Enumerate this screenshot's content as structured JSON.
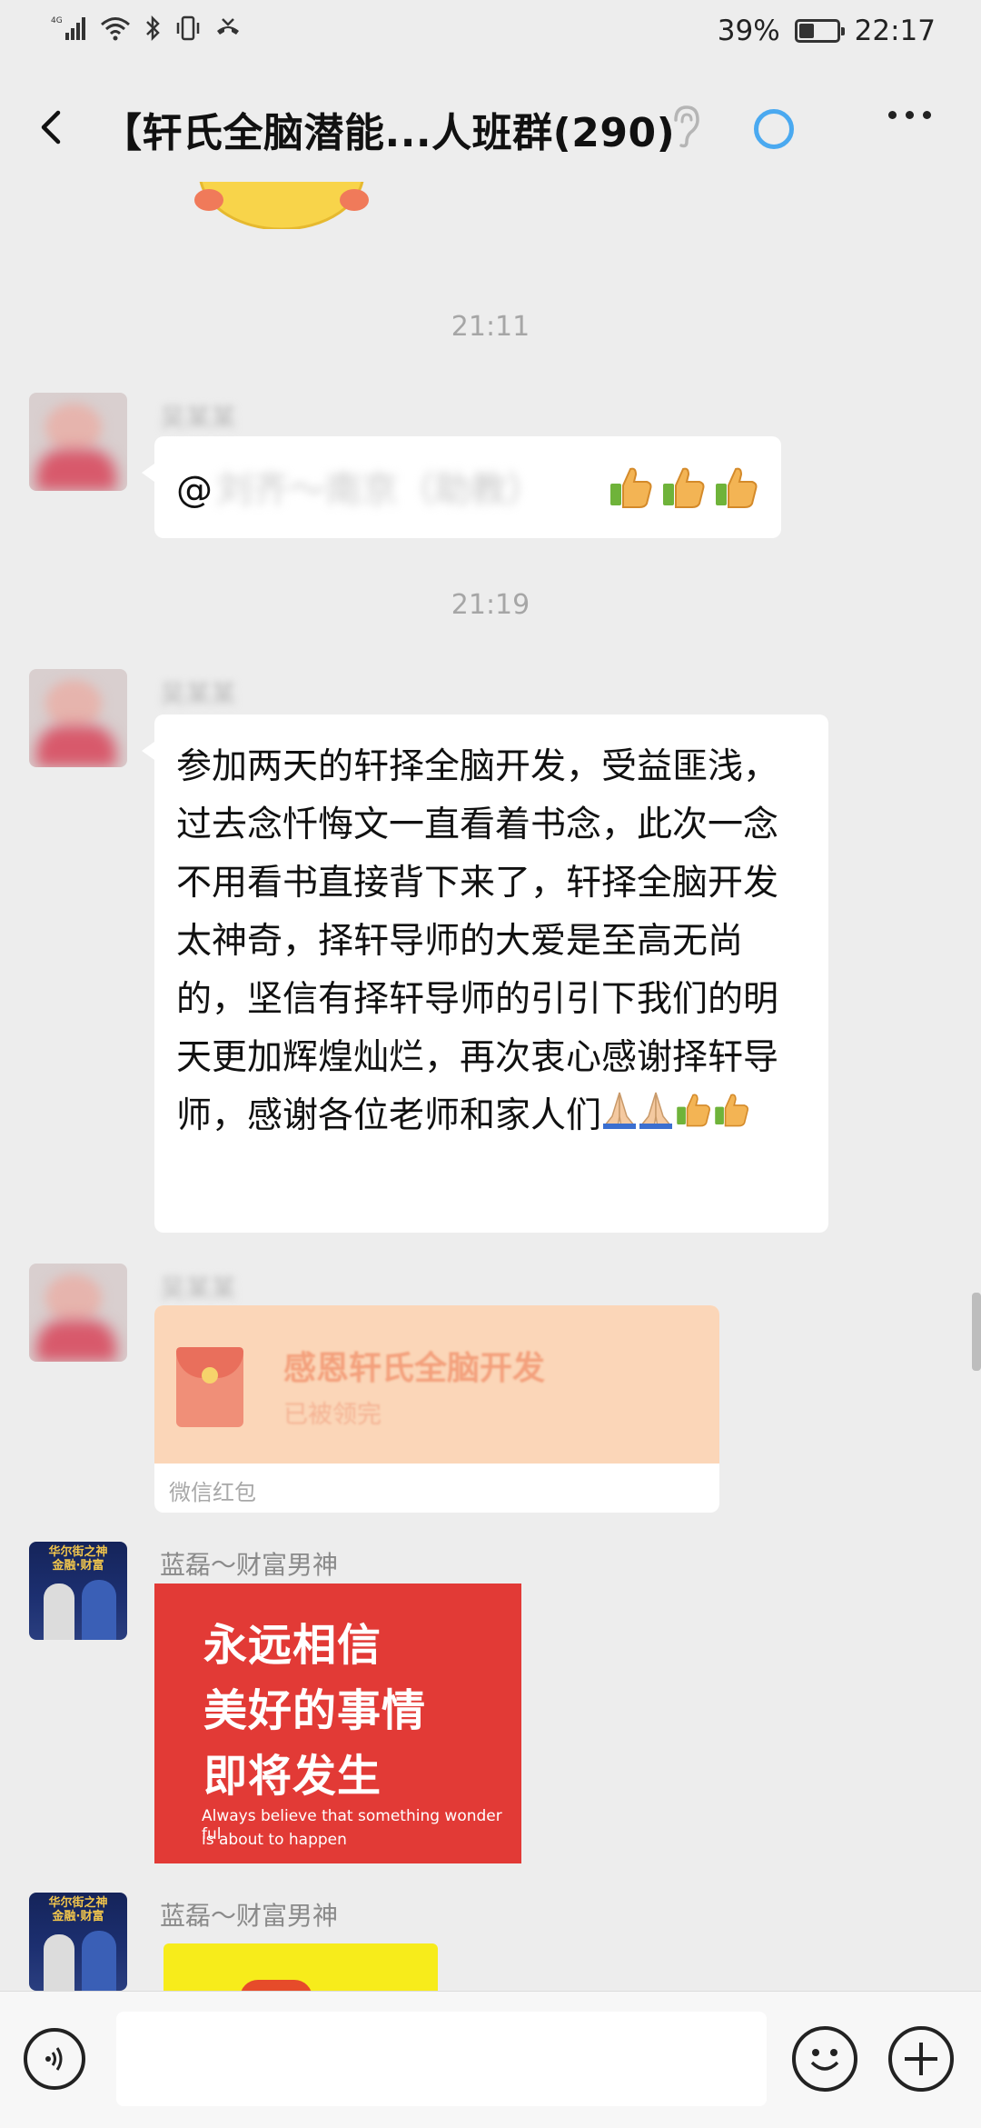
{
  "status_bar": {
    "network": "4G",
    "battery_percent_label": "39%",
    "battery_level": 0.39,
    "time": "22:17",
    "icons": [
      "signal-icon",
      "wifi-icon",
      "bluetooth-icon",
      "vibrate-icon",
      "missed-call-icon"
    ]
  },
  "header": {
    "title": "【轩氏全脑潜能...人班群(290)",
    "icons": [
      "back-icon",
      "ear-icon",
      "loading-icon",
      "more-icon"
    ]
  },
  "messages": {
    "time_1": "21:11",
    "msg1": {
      "mention_prefix": "@",
      "mention_blurred": "刘齐～南京（助教）"
    },
    "time_2": "21:19",
    "msg2": {
      "text": "参加两天的轩择全脑开发，受益匪浅，过去念忏悔文一直看着书念，此次一念不用看书直接背下来了，轩择全脑开发太神奇，择轩导师的大爱是至高无尚的，坚信有择轩导师的引引下我们的明天更加辉煌灿烂，再次衷心感谢择轩导师，感谢各位老师和家人们"
    },
    "red_packet": {
      "title": "感恩轩氏全脑开发",
      "status": "已被领完",
      "footer": "微信红包"
    },
    "msg4": {
      "sender": "蓝磊～财富男神",
      "image_lines": [
        "永远相信",
        "美好的事情",
        "即将发生"
      ],
      "image_en_1": "Always believe that something wonder ful",
      "image_en_2": "is about to happen"
    },
    "msg5": {
      "sender": "蓝磊～财富男神"
    }
  },
  "colors": {
    "background": "#ededed",
    "bubble": "#ffffff",
    "red_card": "#e23a36",
    "red_packet": "#fbd6b8"
  }
}
